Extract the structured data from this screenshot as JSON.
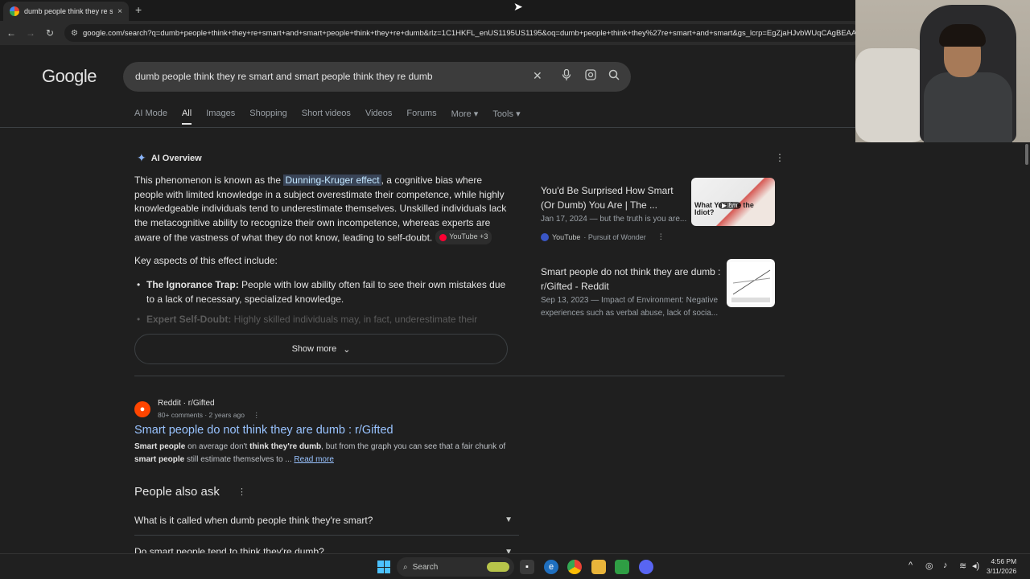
{
  "browser": {
    "tab_title": "dumb people think they re smart and smart people think they re dumb - Google Search",
    "tab_close": "×",
    "new_tab": "+",
    "url": "google.com/search?q=dumb+people+think+they+re+smart+and+smart+people+think+they+re+dumb&rlz=1C1HKFL_enUS1195US1195&oq=dumb+people+think+they%27re+smart+and+smart&gs_lcrp=EgZjaHJvbWUqCAgBEAAYFhgeMgYIABBFGDkyCAgBEAAYFhgeMg"
  },
  "google": {
    "logo": "Google",
    "query": "dumb people think they re smart and smart people think they re dumb",
    "tabs": [
      "AI Mode",
      "All",
      "Images",
      "Shopping",
      "Short videos",
      "Videos",
      "Forums",
      "More",
      "Tools"
    ]
  },
  "ai_overview": {
    "title": "AI Overview",
    "p1_before": "This phenomenon is known as the ",
    "p1_highlight": "Dunning-Kruger effect",
    "p1_after": ", a cognitive bias where people with limited knowledge in a subject overestimate their competence, while highly knowledgeable individuals tend to underestimate themselves. Unskilled individuals lack the metacognitive ability to recognize their own incompetence, whereas experts are aware of the vastness of what they do not know, leading to self-doubt.",
    "source_chip": "YouTube +3",
    "key_aspects": "Key aspects of this effect include:",
    "bullet1_bold": "The Ignorance Trap:",
    "bullet1_text": " People with low ability often fail to see their own mistakes due to a lack of necessary, specialized knowledge.",
    "bullet2_bold": "Expert Self-Doubt:",
    "bullet2_text": " Highly skilled individuals may, in fact, underestimate their abilities",
    "show_more": "Show more"
  },
  "cards": [
    {
      "title": "You'd Be Surprised How Smart (Or Dumb) You Are | The ...",
      "snippet": "Jan 17, 2024 — but the truth is you are...",
      "source": "YouTube",
      "channel": "· Pursuit of Wonder",
      "thumb_text": "What You Are the Idiot?",
      "duration": "▶ 8m"
    },
    {
      "title": "Smart people do not think they are dumb : r/Gifted - Reddit",
      "snippet": "Sep 13, 2023 — Impact of Environment: Negative experiences such as verbal abuse, lack of socia..."
    }
  ],
  "result": {
    "site": "Reddit · r/Gifted",
    "meta": "80+ comments · 2 years ago",
    "title": "Smart people do not think they are dumb : r/Gifted",
    "s1": "Smart people",
    "s2": " on average don't ",
    "s3": "think they're dumb",
    "s4": ", but from the graph you can see that a fair chunk of ",
    "s5": "smart people",
    "s6": " still estimate themselves to ... ",
    "read_more": "Read more"
  },
  "paa": {
    "title": "People also ask",
    "questions": [
      "What is it called when dumb people think they're smart?",
      "Do smart people tend to think they're dumb?"
    ]
  },
  "taskbar": {
    "search": "Search",
    "time": "4:56 PM",
    "date": "3/11/2026"
  }
}
